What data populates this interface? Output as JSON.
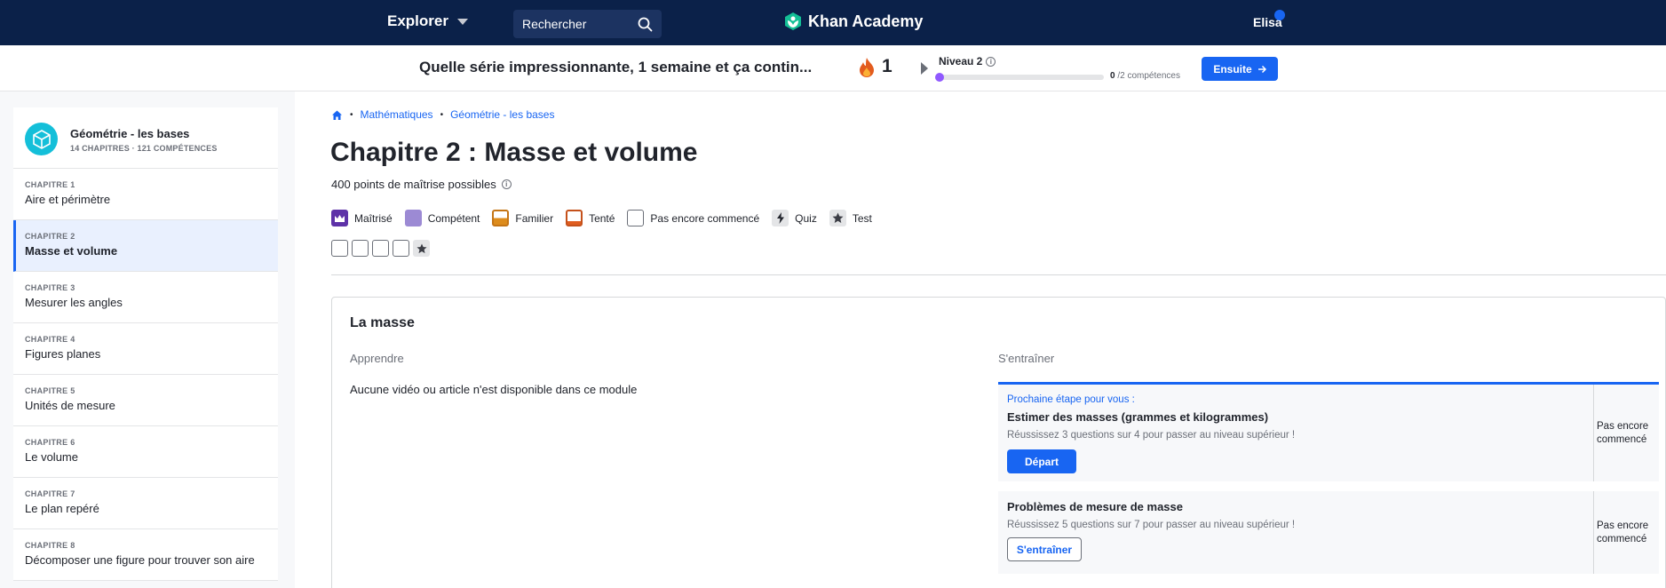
{
  "nav": {
    "explore_label": "Explorer",
    "search_placeholder": "Rechercher",
    "logo_text": "Khan Academy",
    "user_name": "Elisa"
  },
  "streak": {
    "message": "Quelle série impressionnante, 1 semaine et ça contin...",
    "count": "1",
    "level_label": "Niveau 2",
    "level_done": "0",
    "level_total": "/2 compétences",
    "level_fraction": 0,
    "next_label": "Ensuite"
  },
  "course": {
    "title": "Géométrie - les bases",
    "meta": "14 CHAPITRES · 121 COMPÉTENCES"
  },
  "chapters": [
    {
      "num": "CHAPITRE 1",
      "name": "Aire et périmètre"
    },
    {
      "num": "CHAPITRE 2",
      "name": "Masse et volume"
    },
    {
      "num": "CHAPITRE 3",
      "name": "Mesurer les angles"
    },
    {
      "num": "CHAPITRE 4",
      "name": "Figures planes"
    },
    {
      "num": "CHAPITRE 5",
      "name": "Unités de mesure"
    },
    {
      "num": "CHAPITRE 6",
      "name": "Le volume"
    },
    {
      "num": "CHAPITRE 7",
      "name": "Le plan repéré"
    },
    {
      "num": "CHAPITRE 8",
      "name": "Décomposer une figure pour trouver son aire"
    }
  ],
  "breadcrumb": [
    "Mathématiques",
    "Géométrie - les bases"
  ],
  "page": {
    "title": "Chapitre 2 : Masse et volume",
    "points": "400 points de maîtrise possibles"
  },
  "legend": {
    "mastered": "Maîtrisé",
    "proficient": "Compétent",
    "familiar": "Familier",
    "attempted": "Tenté",
    "not_started": "Pas encore commencé",
    "quiz": "Quiz",
    "test": "Test"
  },
  "unit": {
    "title": "La masse",
    "learn_header": "Apprendre",
    "practice_header": "S'entraîner",
    "empty_message": "Aucune vidéo ou article n'est disponible dans ce module",
    "exercises": [
      {
        "next_step": "Prochaine étape pour vous :",
        "name": "Estimer des masses (grammes et kilogrammes)",
        "desc": "Réussissez 3 questions sur 4 pour passer au niveau supérieur !",
        "button": "Départ",
        "status_line1": "Pas encore",
        "status_line2": "commencé"
      },
      {
        "name": "Problèmes de mesure de masse",
        "desc": "Réussissez 5 questions sur 7 pour passer au niveau supérieur !",
        "button": "S'entraîner",
        "status_line1": "Pas encore",
        "status_line2": "commencé"
      }
    ]
  },
  "colors": {
    "nav_bg": "#0b2149",
    "accent": "#1865f2",
    "mastered": "#5e32a8",
    "proficient": "#9c8ad4",
    "familiar": "#dd8c1c",
    "attempted": "#e05d1f"
  },
  "icons": [
    "chevron-down-icon",
    "search-icon",
    "khan-logo-icon",
    "flame-icon",
    "play-icon",
    "info-icon",
    "arrow-right-icon",
    "cube-icon",
    "home-icon",
    "crown-icon",
    "lightning-icon",
    "star-icon"
  ]
}
